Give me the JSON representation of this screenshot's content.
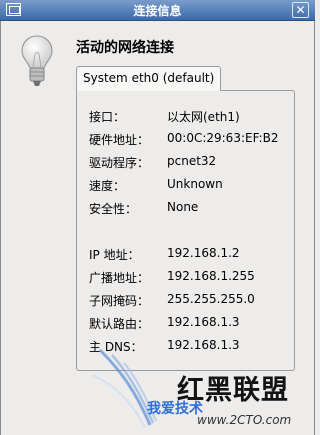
{
  "window": {
    "title": "连接信息"
  },
  "icons": {
    "window": "window-icon",
    "close": "close-icon",
    "bulb": "light-bulb-icon"
  },
  "heading": "活动的网络连接",
  "tab": {
    "label": "System eth0 (default)"
  },
  "info": [
    {
      "label": "接口：",
      "value": "以太网(eth1)"
    },
    {
      "label": "硬件地址：",
      "value": "00:0C:29:63:EF:B2"
    },
    {
      "label": "驱动程序：",
      "value": "pcnet32"
    },
    {
      "label": "速度：",
      "value": "Unknown"
    },
    {
      "label": "安全性：",
      "value": "None"
    }
  ],
  "ip": [
    {
      "label": "IP 地址：",
      "value": "192.168.1.2"
    },
    {
      "label": "广播地址：",
      "value": "192.168.1.255"
    },
    {
      "label": "子网掩码：",
      "value": "255.255.255.0"
    },
    {
      "label": "默认路由：",
      "value": "192.168.1.3"
    },
    {
      "label": "主 DNS：",
      "value": "192.168.1.3"
    }
  ],
  "watermark": {
    "text": "红黑联盟",
    "subtext": "我爱技术",
    "url": "www.2CTO.com"
  },
  "colors": {
    "titlebar": "#3b6aa9",
    "background": "#edeceb",
    "watermark_blue": "#2c6fd6"
  }
}
